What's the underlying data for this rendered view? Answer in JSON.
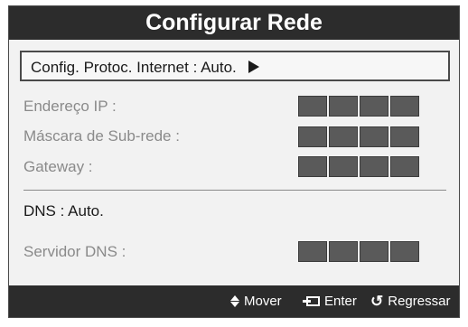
{
  "title": "Configurar Rede",
  "protocol": {
    "label": "Config. Protoc. Internet",
    "value": ": Auto."
  },
  "fields": {
    "ip": "Endereço IP :",
    "mask": "Máscara de Sub-rede :",
    "gateway": "Gateway :"
  },
  "dns": {
    "label": "DNS",
    "value": ": Auto.",
    "server_label": "Servidor DNS :"
  },
  "footer": {
    "move": "Mover",
    "enter": "Enter",
    "back": "Regressar"
  },
  "icons": {
    "move": "up-down-arrow-icon",
    "enter": "enter-icon",
    "back": "return-icon",
    "select": "right-arrow-icon"
  },
  "colors": {
    "bar": "#2c2c2c",
    "panel": "#f2f2f2",
    "box": "#5a5a5a",
    "disabled_text": "#8a8a8a"
  }
}
